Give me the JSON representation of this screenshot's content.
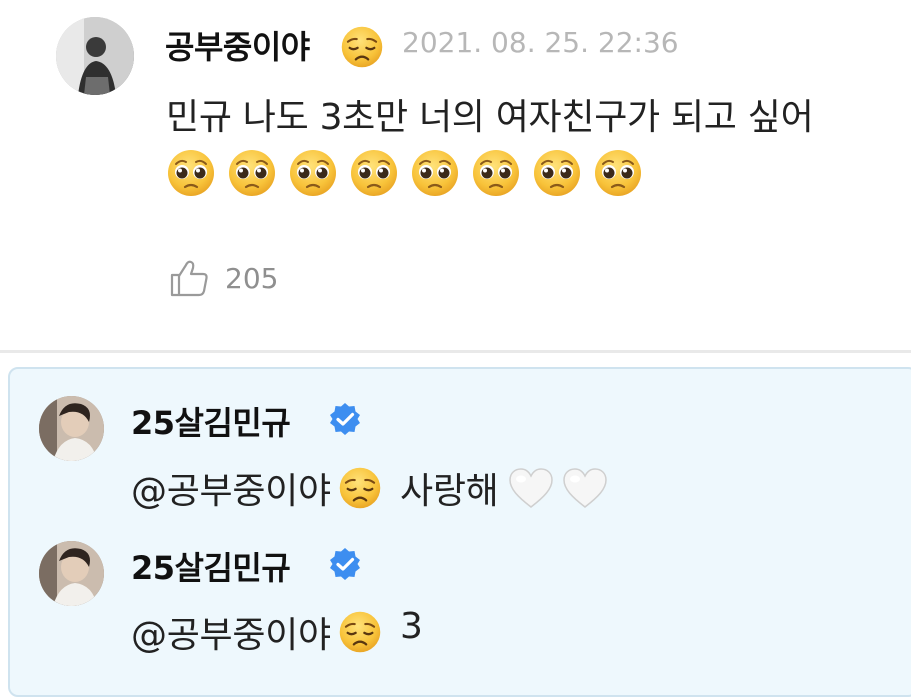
{
  "comment": {
    "nickname": "공부중이야",
    "nickname_emoji": "disappointed-face",
    "date": "2021. 08. 25. 22:36",
    "text": "민규 나도 3초만 너의 여자친구가 되고 싶어",
    "emoji_row": [
      "pleading-face",
      "pleading-face",
      "pleading-face",
      "pleading-face",
      "pleading-face",
      "pleading-face",
      "pleading-face",
      "pleading-face"
    ],
    "like_count": "205"
  },
  "replies": [
    {
      "nickname": "25살김민규",
      "verified": true,
      "mention": "@공부중이야",
      "mention_emoji": "disappointed-face",
      "text": "사랑해",
      "trailing_emojis": [
        "white-heart",
        "white-heart"
      ]
    },
    {
      "nickname": "25살김민규",
      "verified": true,
      "mention": "@공부중이야",
      "mention_emoji": "disappointed-face",
      "text": "3",
      "trailing_emojis": []
    }
  ],
  "colors": {
    "reply_background": "#eef8fd",
    "reply_border": "#cfe3ef",
    "verified_blue": "#3d8ef0",
    "date_gray": "#b7b7b7",
    "emoji_yellow": "#f8c33a"
  }
}
